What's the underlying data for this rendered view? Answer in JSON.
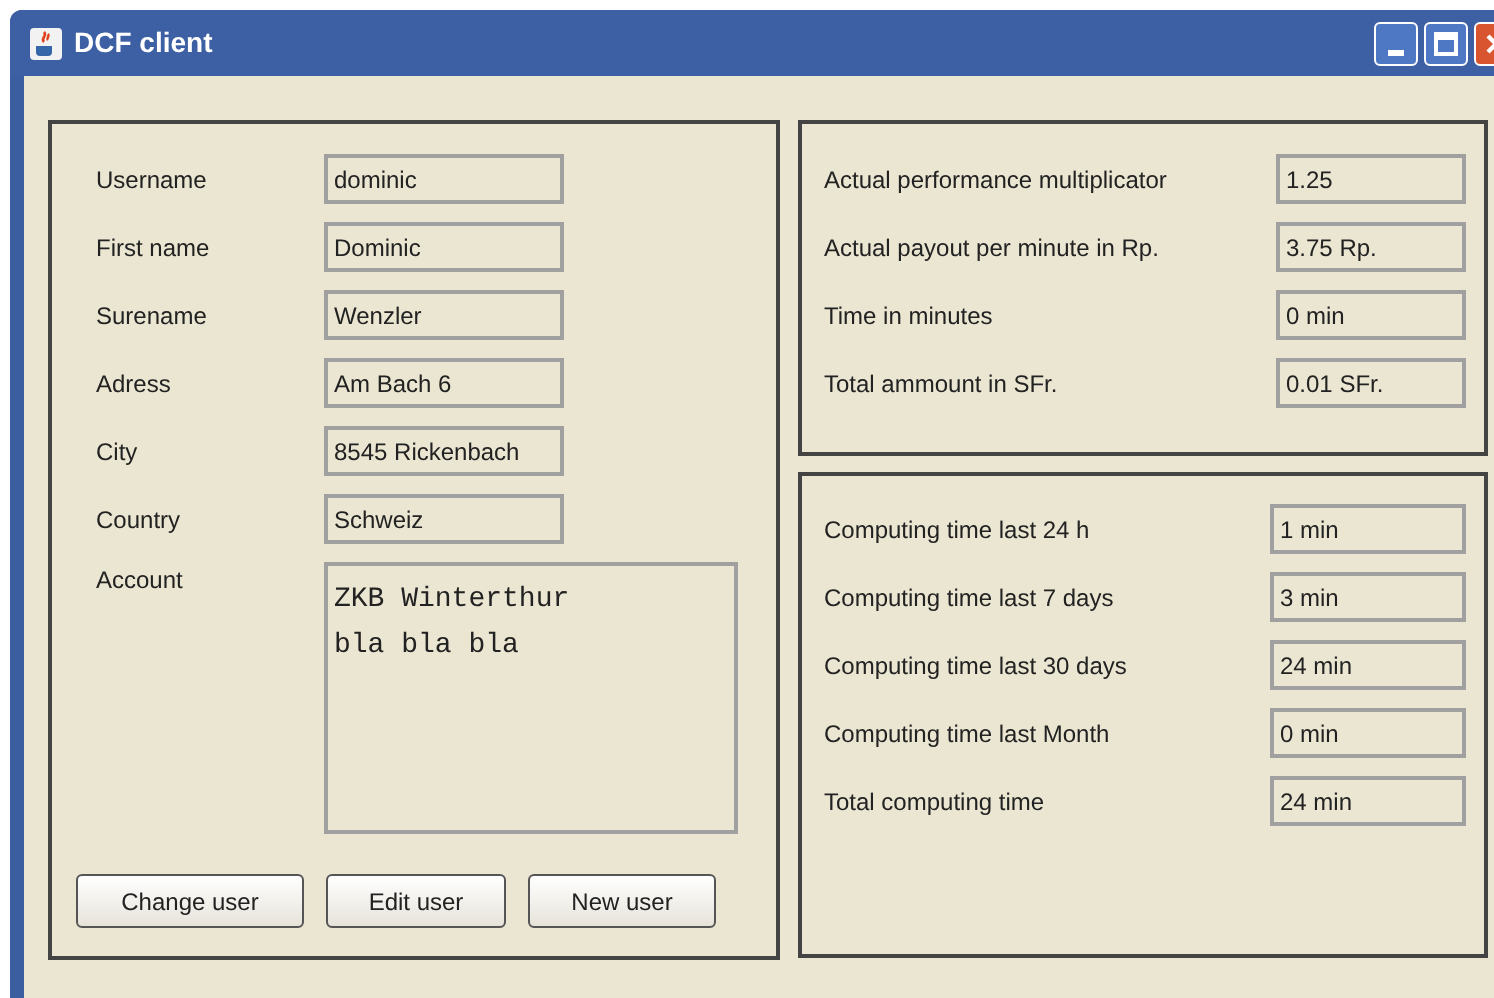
{
  "window": {
    "title": "DCF client"
  },
  "user_form": {
    "fields": [
      {
        "label": "Username",
        "value": "dominic"
      },
      {
        "label": "First name",
        "value": "Dominic"
      },
      {
        "label": "Surename",
        "value": "Wenzler"
      },
      {
        "label": "Adress",
        "value": "Am Bach 6"
      },
      {
        "label": "City",
        "value": "8545 Rickenbach"
      },
      {
        "label": "Country",
        "value": "Schweiz"
      }
    ],
    "account": {
      "label": "Account",
      "lines": [
        "ZKB Winterthur",
        "bla bla bla"
      ]
    },
    "buttons": [
      "Change user",
      "Edit user",
      "New user"
    ]
  },
  "payout": [
    {
      "label": "Actual performance multiplicator",
      "value": "1.25"
    },
    {
      "label": "Actual payout per minute in Rp.",
      "value": "3.75 Rp."
    },
    {
      "label": "Time in minutes",
      "value": "0 min"
    },
    {
      "label": "Total ammount in SFr.",
      "value": "0.01 SFr."
    }
  ],
  "computing": [
    {
      "label": "Computing time last 24 h",
      "value": "1 min"
    },
    {
      "label": "Computing time last 7 days",
      "value": "3 min"
    },
    {
      "label": "Computing time last 30 days",
      "value": "24 min"
    },
    {
      "label": "Computing time last Month",
      "value": "0 min"
    },
    {
      "label": "Total computing time",
      "value": "24 min"
    }
  ]
}
